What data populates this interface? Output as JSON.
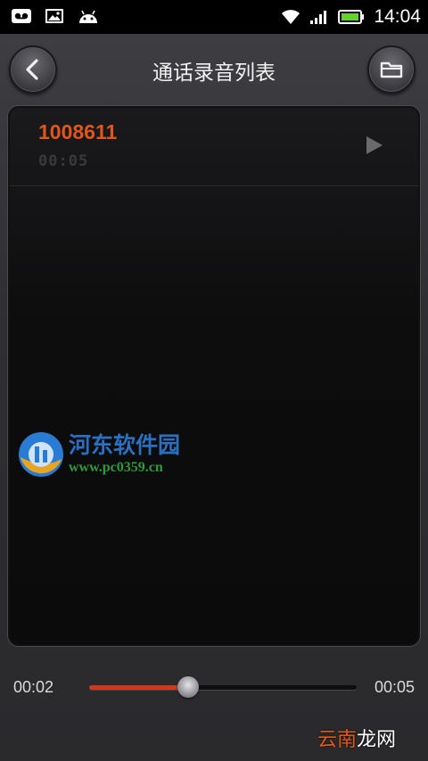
{
  "status_bar": {
    "time": "14:04",
    "icons": [
      "voicemail-icon",
      "image-icon",
      "android-icon",
      "wifi-icon",
      "signal-icon",
      "battery-icon"
    ],
    "battery_color": "#5fd52a"
  },
  "header": {
    "title": "通话录音列表",
    "back_icon": "chevron-left-icon",
    "folder_icon": "folder-icon"
  },
  "recordings": [
    {
      "number": "1008611",
      "duration": "00:05",
      "play_icon": "play-icon"
    }
  ],
  "watermark": {
    "name": "河东软件园",
    "url": "www.pc0359.cn"
  },
  "player": {
    "current_time": "00:02",
    "total_time": "00:05",
    "progress_fraction": 0.37,
    "accent_color": "#d0391b"
  },
  "footer_watermark": {
    "part1": "云南",
    "part2": "龙网"
  }
}
